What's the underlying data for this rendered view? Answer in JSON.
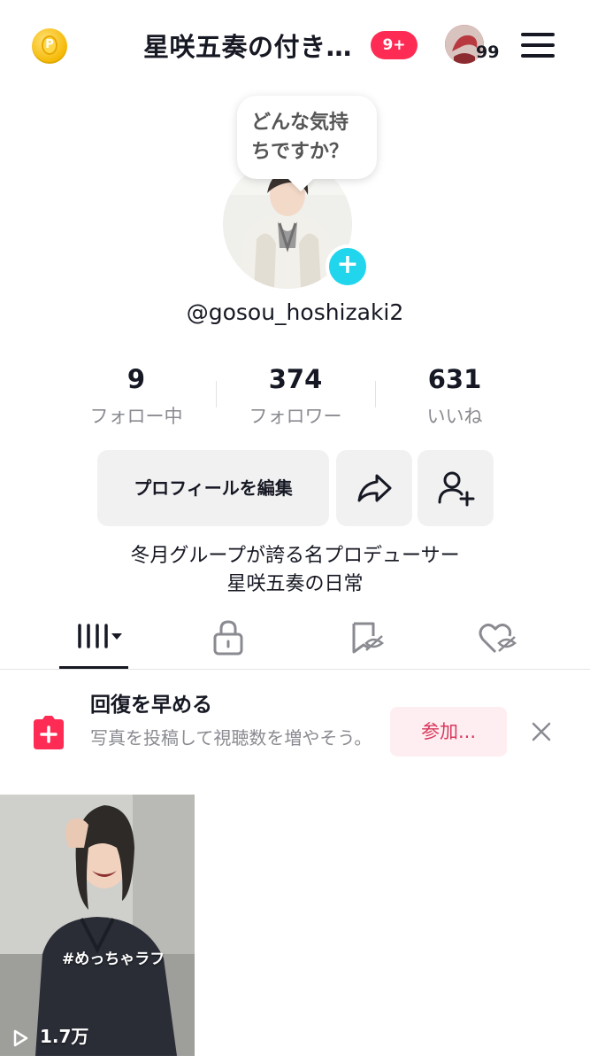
{
  "header": {
    "coin_letter": "P",
    "title": "星咲五奏の付き…",
    "notification_badge": "9+",
    "avatar_count": "99"
  },
  "profile": {
    "mood_prompt_line1": "どんな気持",
    "mood_prompt_line2": "ちですか？",
    "add_symbol": "+",
    "username": "@gosou_hoshizaki2"
  },
  "stats": [
    {
      "value": "9",
      "label": "フォロー中"
    },
    {
      "value": "374",
      "label": "フォロワー"
    },
    {
      "value": "631",
      "label": "いいね"
    }
  ],
  "actions": {
    "edit_profile": "プロフィールを編集"
  },
  "bio": {
    "line1": "冬月グループが誇る名プロデューサー",
    "line2": "星咲五奏の日常"
  },
  "promo": {
    "title": "回復を早める",
    "description": "写真を投稿して視聴数を増やそう。",
    "join_label": "参加..."
  },
  "videos": [
    {
      "hashtag": "#めっちゃラフ",
      "views": "1.7万"
    }
  ],
  "colors": {
    "accent_red": "#fe2c55",
    "accent_cyan": "#20d5ec",
    "join_text": "#d8385d"
  }
}
